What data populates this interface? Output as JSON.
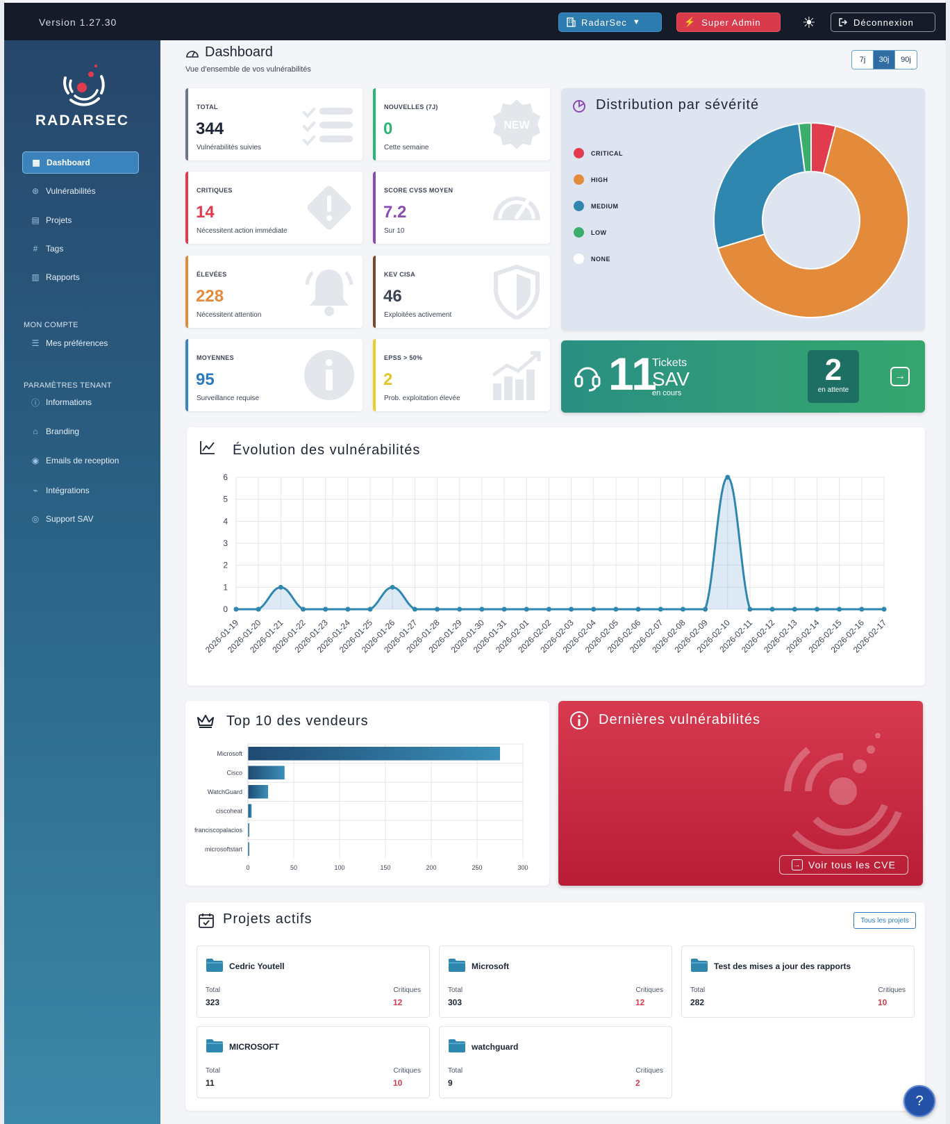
{
  "topbar": {
    "version": "Version 1.27.30",
    "tenant_label": "RadarSec",
    "admin_label": "Super Admin",
    "logout_label": "Déconnexion"
  },
  "sidebar": {
    "brand": "RADARSEC",
    "nav": [
      {
        "label": "Dashboard",
        "icon": "dashboard-icon",
        "active": true
      },
      {
        "label": "Vulnérabilités",
        "icon": "bug-icon"
      },
      {
        "label": "Projets",
        "icon": "folder-icon"
      },
      {
        "label": "Tags",
        "icon": "hash-icon"
      },
      {
        "label": "Rapports",
        "icon": "report-icon"
      }
    ],
    "section_account": "MON COMPTE",
    "account_items": [
      {
        "label": "Mes préférences",
        "icon": "sliders-icon"
      }
    ],
    "section_tenant": "PARAMÈTRES TENANT",
    "tenant_items": [
      {
        "label": "Informations",
        "icon": "info-icon"
      },
      {
        "label": "Branding",
        "icon": "brush-icon"
      },
      {
        "label": "Emails de reception",
        "icon": "mail-icon"
      },
      {
        "label": "Intégrations",
        "icon": "plug-icon"
      },
      {
        "label": "Support SAV",
        "icon": "support-icon"
      }
    ]
  },
  "header": {
    "title": "Dashboard",
    "subtitle": "Vue d'ensemble de vos vulnérabilités",
    "ranges": [
      "7j",
      "30j",
      "90j"
    ],
    "active_range": "30j"
  },
  "stats": [
    {
      "label": "TOTAL",
      "value": "344",
      "sub": "Vulnérabilités suivies",
      "color": "#6c7684",
      "value_color": "#1b2533",
      "icon": "checklist-icon"
    },
    {
      "label": "NOUVELLES (7J)",
      "value": "0",
      "sub": "Cette semaine",
      "color": "#2bb673",
      "value_color": "#2bb673",
      "icon": "new-badge-icon"
    },
    {
      "label": "CRITIQUES",
      "value": "14",
      "sub": "Nécessitent action immédiate",
      "color": "#e23b4e",
      "value_color": "#e23b4e",
      "icon": "warning-diamond-icon"
    },
    {
      "label": "SCORE CVSS MOYEN",
      "value": "7.2",
      "sub": "Sur 10",
      "color": "#8a4bb3",
      "value_color": "#8a4bb3",
      "icon": "gauge-icon"
    },
    {
      "label": "ÉLEVÉES",
      "value": "228",
      "sub": "Nécessitent attention",
      "color": "#e38a3b",
      "value_color": "#e38a3b",
      "icon": "bell-icon"
    },
    {
      "label": "KEV CISA",
      "value": "46",
      "sub": "Exploitées activement",
      "color": "#7a4a2e",
      "value_color": "#3a4454",
      "icon": "shield-icon"
    },
    {
      "label": "MOYENNES",
      "value": "95",
      "sub": "Surveillance requise",
      "color": "#3a86c3",
      "value_color": "#2b7bbf",
      "icon": "info-circle-icon"
    },
    {
      "label": "EPSS > 50%",
      "value": "2",
      "sub": "Prob. exploitation élevée",
      "color": "#e8cf2a",
      "value_color": "#e3c42a",
      "icon": "growth-chart-icon"
    }
  ],
  "severity": {
    "title": "Distribution par sévérité",
    "legend": [
      {
        "label": "CRITICAL",
        "color": "#e23b4e"
      },
      {
        "label": "HIGH",
        "color": "#e38a3b"
      },
      {
        "label": "MEDIUM",
        "color": "#2f86ae"
      },
      {
        "label": "LOW",
        "color": "#3aae6a"
      },
      {
        "label": "NONE",
        "color": "#ffffff"
      }
    ]
  },
  "tickets": {
    "count": "11",
    "line1": "Tickets",
    "line2": "SAV",
    "line3": "en cours",
    "pending": "2",
    "pending_label": "en attente"
  },
  "evolution_title": "Évolution des vulnérabilités",
  "vendors_title": "Top 10 des vendeurs",
  "latest": {
    "title": "Dernières vulnérabilités",
    "button": "Voir tous les CVE"
  },
  "projects": {
    "title": "Projets actifs",
    "all_label": "Tous les projets",
    "total_label": "Total",
    "crit_label": "Critiques",
    "items": [
      {
        "name": "Cedric Youtell",
        "total": "323",
        "critical": "12"
      },
      {
        "name": "Microsoft",
        "total": "303",
        "critical": "12"
      },
      {
        "name": "Test des mises a jour des rapports",
        "total": "282",
        "critical": "10"
      },
      {
        "name": "MICROSOFT",
        "total": "11",
        "critical": "10"
      },
      {
        "name": "watchguard",
        "total": "9",
        "critical": "2"
      }
    ]
  },
  "chart_data": [
    {
      "type": "pie",
      "title": "Distribution par sévérité",
      "categories": [
        "CRITICAL",
        "HIGH",
        "MEDIUM",
        "LOW",
        "NONE"
      ],
      "values": [
        14,
        228,
        95,
        7,
        0
      ],
      "colors": [
        "#e23b4e",
        "#e38a3b",
        "#2f86ae",
        "#3aae6a",
        "#ffffff"
      ],
      "legend": "left"
    },
    {
      "type": "area",
      "title": "Évolution des vulnérabilités",
      "x": [
        "2026-01-19",
        "2026-01-20",
        "2026-01-21",
        "2026-01-22",
        "2026-01-23",
        "2026-01-24",
        "2026-01-25",
        "2026-01-26",
        "2026-01-27",
        "2026-01-28",
        "2026-01-29",
        "2026-01-30",
        "2026-01-31",
        "2026-02-01",
        "2026-02-02",
        "2026-02-03",
        "2026-02-04",
        "2026-02-05",
        "2026-02-06",
        "2026-02-07",
        "2026-02-08",
        "2026-02-09",
        "2026-02-10",
        "2026-02-11",
        "2026-02-12",
        "2026-02-13",
        "2026-02-14",
        "2026-02-15",
        "2026-02-16",
        "2026-02-17"
      ],
      "values": [
        0,
        0,
        1,
        0,
        0,
        0,
        0,
        1,
        0,
        0,
        0,
        0,
        0,
        0,
        0,
        0,
        0,
        0,
        0,
        0,
        0,
        0,
        6,
        0,
        0,
        0,
        0,
        0,
        0,
        0
      ],
      "yticks": [
        0,
        1,
        2,
        3,
        4,
        5,
        6
      ],
      "ylim": [
        0,
        6
      ],
      "grid": true
    },
    {
      "type": "bar",
      "title": "Top 10 des vendeurs",
      "orientation": "horizontal",
      "categories": [
        "Microsoft",
        "Cisco",
        "WatchGuard",
        "ciscoheat",
        "franciscopalacios",
        "microsoftstart"
      ],
      "values": [
        275,
        40,
        22,
        4,
        1,
        1
      ],
      "xticks": [
        0,
        50,
        100,
        150,
        200,
        250,
        300
      ],
      "xlim": [
        0,
        300
      ],
      "grid": true
    }
  ]
}
